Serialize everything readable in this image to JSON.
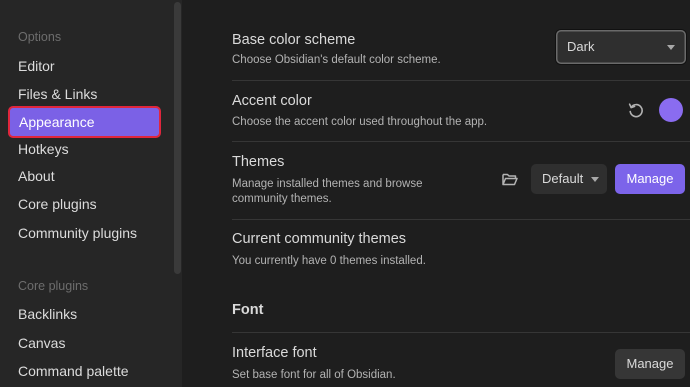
{
  "sidebar": {
    "options_label": "Options",
    "options_items": [
      "Editor",
      "Files & Links",
      "Appearance",
      "Hotkeys",
      "About",
      "Core plugins",
      "Community plugins"
    ],
    "core_plugins_label": "Core plugins",
    "core_items": [
      "Backlinks",
      "Canvas",
      "Command palette"
    ],
    "active_item": "Appearance"
  },
  "main": {
    "base_color": {
      "title": "Base color scheme",
      "desc": "Choose Obsidian's default color scheme.",
      "value": "Dark"
    },
    "accent": {
      "title": "Accent color",
      "desc": "Choose the accent color used throughout the app.",
      "color": "#8a6cf0"
    },
    "themes": {
      "title": "Themes",
      "desc": "Manage installed themes and browse community themes.",
      "value": "Default",
      "button": "Manage"
    },
    "community_themes": {
      "title": "Current community themes",
      "desc": "You currently have 0 themes installed."
    },
    "font_heading": "Font",
    "interface_font": {
      "title": "Interface font",
      "desc": "Set base font for all of Obsidian.",
      "button": "Manage"
    }
  },
  "icons": {
    "reset": "reset-icon",
    "folder": "folder-icon",
    "caret": "chevron-down-icon"
  }
}
